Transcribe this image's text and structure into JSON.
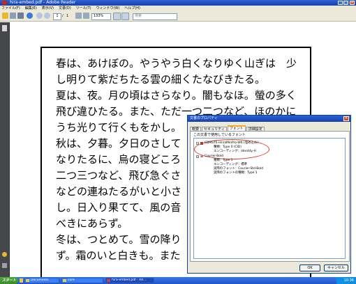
{
  "window": {
    "title": "hira-embed.pdf - Adobe Reader"
  },
  "menu": [
    "ファイル(F)",
    "編集(E)",
    "表示(V)",
    "文書(D)",
    "ツール(T)",
    "ウィンドウ(W)",
    "ヘルプ(H)"
  ],
  "toolbar": {
    "page_current": "1",
    "page_separator": "/",
    "page_total": "1",
    "zoom": "133%",
    "search_placeholder": "検索"
  },
  "document": {
    "lines": [
      "春は、あけぼの。やうやう白くなりゆく山ぎは　少",
      "し明りて紫だちたる雲の細くたなびきたる。",
      "夏は、夜。月の頃はさらなり。闇もなほ。螢の多く",
      "飛び違ひたる。また、ただ一つ二つなど、ほのかに",
      "うち光りて行くもをかし。",
      "秋は、夕暮。夕日のさして",
      "なりたるに、烏の寝どころ",
      "二つ三つなど、飛び急ぐさ",
      "などの連ねたるがいと小さ",
      "し。日入り果てて、風の音",
      "べきにあらず。",
      "冬は、つとめて。雪の降り",
      "ず。霜のいと白きも。また"
    ]
  },
  "dialog": {
    "title": "文書のプロパティ",
    "tabs": [
      "概要",
      "セキュリティ",
      "フォント",
      "詳細設定"
    ],
    "active_tab": "フォント",
    "fonts_label": "この文書で使用しているフォント",
    "fonts": [
      {
        "name": "GBMSTS+HiraMinPro-W6 (埋め込み)",
        "details": [
          "種類：Type 0 (CID)",
          "エンコーディング：Identity-H"
        ]
      },
      {
        "name": "Courier-Bold",
        "details": [
          "種類：Type 1",
          "エンコーディング：標準",
          "実際のフォント：Courier-Std-Bold",
          "実際のフォントの種類：Type 1"
        ]
      }
    ],
    "ok_label": "OK",
    "cancel_label": "キャンセル"
  },
  "taskbar": {
    "start_label": "スタート",
    "items": [
      "Documents",
      "core",
      "hira-embed.pdf - Ad..."
    ],
    "clock": "10:36"
  },
  "colors": {
    "titlebar": "#1740a8",
    "chrome": "#ece9d8",
    "highlight_oval": "#d9432c",
    "taskbar": "#2a62d6"
  }
}
